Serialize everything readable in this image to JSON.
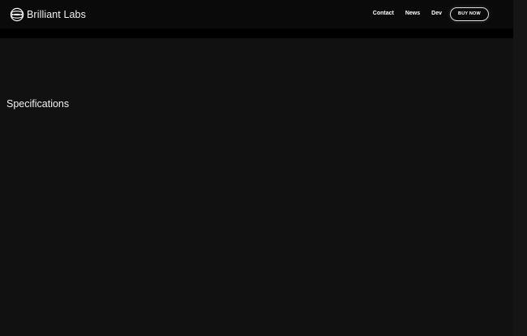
{
  "header": {
    "brand": "Brilliant Labs",
    "logo_icon": "brilliant-labs-logo-icon",
    "nav": [
      {
        "label": "Contact"
      },
      {
        "label": "News"
      },
      {
        "label": "Dev"
      }
    ],
    "cta_label": "BUY NOW"
  },
  "main": {
    "section_title": "Specifications"
  },
  "colors": {
    "background": "#111111",
    "header_background": "#0a0a0a",
    "text": "#ffffff"
  }
}
